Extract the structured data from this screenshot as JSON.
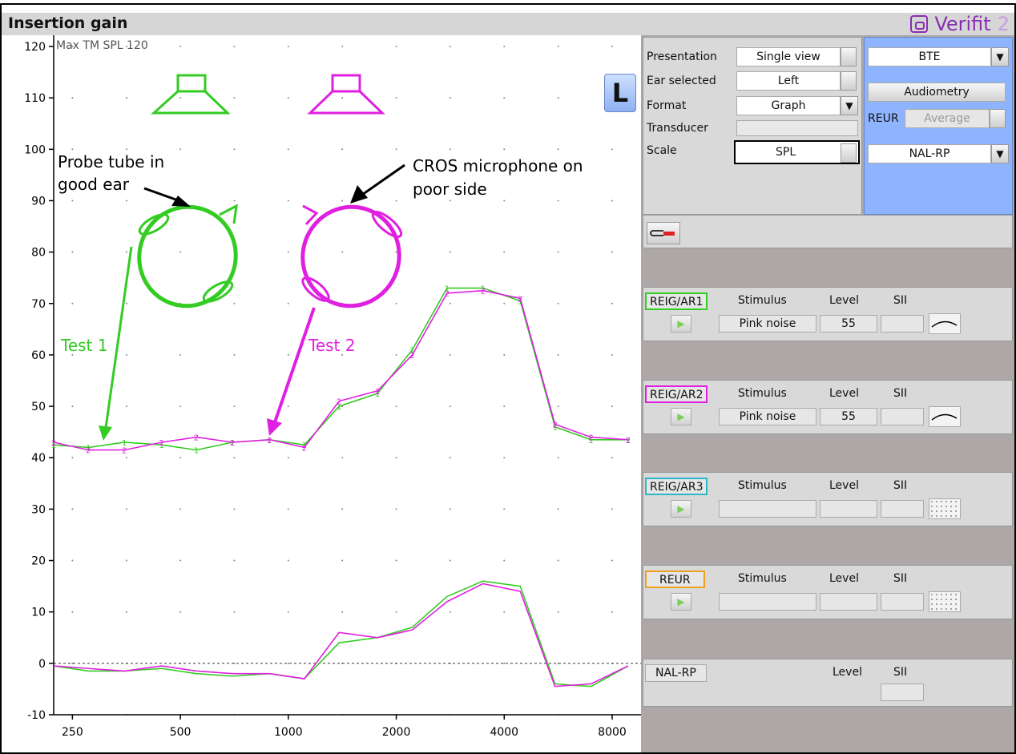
{
  "titlebar": {
    "title": "Insertion gain",
    "brand_name": "Verifit",
    "brand_version": "2"
  },
  "graph": {
    "max_tm_spl": "Max TM SPL 120",
    "ear_badge": "L",
    "y_ticks": [
      "120",
      "110",
      "100",
      "90",
      "80",
      "70",
      "60",
      "50",
      "40",
      "30",
      "20",
      "10",
      "0",
      "-10"
    ],
    "x_ticks": [
      "250",
      "500",
      "1000",
      "2000",
      "4000",
      "8000"
    ],
    "annotations": {
      "probe_tube_line1": "Probe tube in",
      "probe_tube_line2": "good ear",
      "cros_line1": "CROS microphone on",
      "cros_line2": "poor side",
      "test1": "Test 1",
      "test2": "Test 2"
    },
    "colors": {
      "test1": "#33cc22",
      "test2": "#e020e0",
      "test3": "#2ab8c8",
      "reur": "#f0a020"
    }
  },
  "chart_data": {
    "type": "line",
    "title": "Insertion gain",
    "xlabel": "",
    "ylabel": "",
    "x_scale": "log",
    "xlim": [
      200,
      8000
    ],
    "ylim": [
      -10,
      120
    ],
    "x": [
      200,
      250,
      315,
      400,
      500,
      630,
      800,
      1000,
      1250,
      1600,
      2000,
      2500,
      3150,
      4000,
      5000,
      6300,
      8000
    ],
    "series": [
      {
        "name": "REIG/AR1",
        "kind": "aided",
        "values": [
          42.5,
          42,
          43,
          42.5,
          41.5,
          43,
          43.5,
          42.5,
          50,
          52.5,
          61,
          73,
          73,
          70.5,
          46,
          43.5,
          43.5
        ]
      },
      {
        "name": "REIG/AR2",
        "kind": "aided",
        "values": [
          43,
          41.5,
          41.5,
          43,
          44,
          43,
          43.5,
          42,
          51,
          53,
          60,
          72,
          72.5,
          71,
          46.5,
          44,
          43.5
        ]
      },
      {
        "name": "REIG/AR1",
        "kind": "gain",
        "values": [
          -0.5,
          -1.5,
          -1.5,
          -1,
          -2,
          -2.5,
          -2,
          -3,
          4,
          5,
          7,
          13,
          16,
          15,
          -4,
          -4.5,
          -0.5
        ]
      },
      {
        "name": "REIG/AR2",
        "kind": "gain",
        "values": [
          -0.5,
          -1,
          -1.5,
          -0.5,
          -1.5,
          -2,
          -2,
          -3,
          6,
          5,
          6.5,
          12,
          15.5,
          14,
          -4.5,
          -4,
          -0.5
        ]
      }
    ],
    "grid": "dots"
  },
  "settings": {
    "presentation_label": "Presentation",
    "presentation_value": "Single view",
    "ear_label": "Ear selected",
    "ear_value": "Left",
    "format_label": "Format",
    "format_value": "Graph",
    "transducer_label": "Transducer",
    "transducer_value": "",
    "scale_label": "Scale",
    "scale_value": "SPL"
  },
  "side_settings": {
    "style_value": "BTE",
    "audiometry_label": "Audiometry",
    "reur_label": "REUR",
    "reur_value": "Average",
    "target_value": "NAL-RP"
  },
  "tests": [
    {
      "tag": "REIG/AR1",
      "stimulus_head": "Stimulus",
      "level_head": "Level",
      "sii_head": "SII",
      "stimulus": "Pink noise",
      "level": "55",
      "sii": ""
    },
    {
      "tag": "REIG/AR2",
      "stimulus_head": "Stimulus",
      "level_head": "Level",
      "sii_head": "SII",
      "stimulus": "Pink noise",
      "level": "55",
      "sii": ""
    },
    {
      "tag": "REIG/AR3",
      "stimulus_head": "Stimulus",
      "level_head": "Level",
      "sii_head": "SII",
      "stimulus": "",
      "level": "",
      "sii": ""
    },
    {
      "tag": "REUR",
      "stimulus_head": "Stimulus",
      "level_head": "Level",
      "sii_head": "SII",
      "stimulus": "",
      "level": "",
      "sii": ""
    }
  ],
  "nal": {
    "tag": "NAL-RP",
    "level_head": "Level",
    "sii_head": "SII"
  }
}
